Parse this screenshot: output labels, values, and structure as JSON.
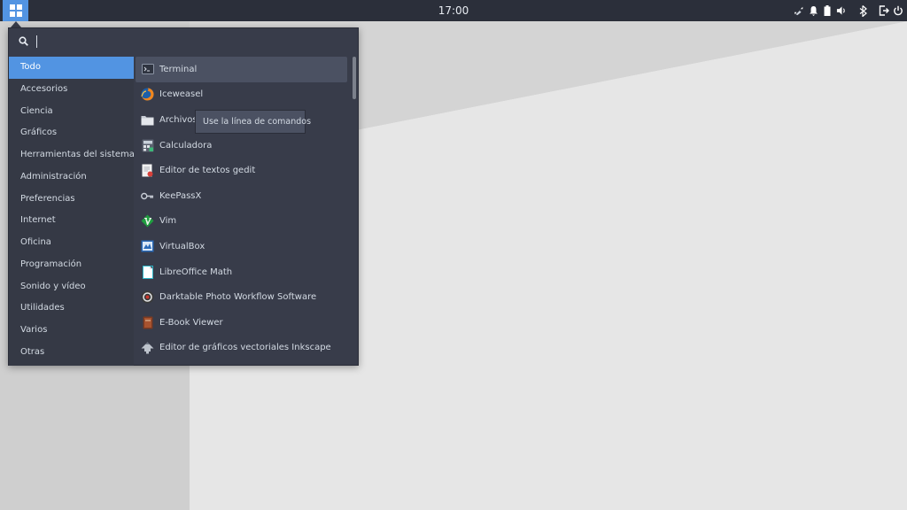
{
  "panel": {
    "clock": "17:00",
    "tray_icons": [
      "network-icon",
      "bell-icon",
      "battery-icon",
      "volume-icon",
      "bluetooth-icon",
      "logout-icon",
      "power-icon"
    ]
  },
  "menu": {
    "search": {
      "value": "",
      "placeholder": ""
    },
    "categories": [
      {
        "label": "Todo",
        "active": true
      },
      {
        "label": "Accesorios"
      },
      {
        "label": "Ciencia"
      },
      {
        "label": "Gráficos"
      },
      {
        "label": "Herramientas del sistema"
      },
      {
        "label": "Administración"
      },
      {
        "label": "Preferencias"
      },
      {
        "label": "Internet"
      },
      {
        "label": "Oficina"
      },
      {
        "label": "Programación"
      },
      {
        "label": "Sonido y vídeo"
      },
      {
        "label": "Utilidades"
      },
      {
        "label": "Varios"
      },
      {
        "label": "Otras"
      }
    ],
    "apps": [
      {
        "label": "Terminal",
        "icon": "terminal-icon",
        "active": true
      },
      {
        "label": "Iceweasel",
        "icon": "firefox-icon"
      },
      {
        "label": "Archivos",
        "icon": "folder-icon"
      },
      {
        "label": "Calculadora",
        "icon": "calculator-icon"
      },
      {
        "label": "Editor de textos gedit",
        "icon": "text-editor-icon"
      },
      {
        "label": "KeePassX",
        "icon": "key-icon"
      },
      {
        "label": "Vim",
        "icon": "vim-icon"
      },
      {
        "label": "VirtualBox",
        "icon": "virtualbox-icon"
      },
      {
        "label": "LibreOffice Math",
        "icon": "libreoffice-math-icon"
      },
      {
        "label": "Darktable Photo Workflow Software",
        "icon": "darktable-icon"
      },
      {
        "label": "E-Book Viewer",
        "icon": "ebook-icon"
      },
      {
        "label": "Editor de gráficos vectoriales Inkscape",
        "icon": "inkscape-icon"
      }
    ],
    "tooltip": "Use la línea de comandos"
  },
  "colors": {
    "accent": "#5294e2",
    "panel_bg": "#2b2f3a",
    "menu_bg": "#383c4a"
  }
}
